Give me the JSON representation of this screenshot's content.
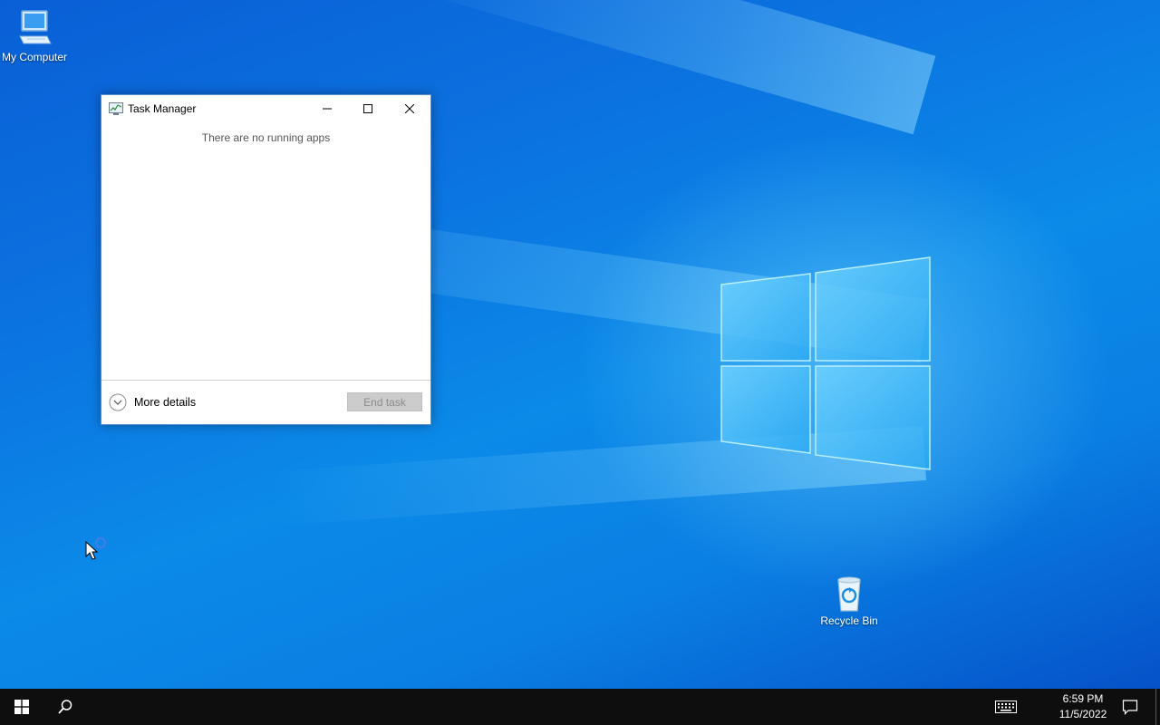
{
  "desktop": {
    "icons": [
      {
        "label": "My Computer"
      },
      {
        "label": "Recycle Bin"
      }
    ]
  },
  "task_manager": {
    "title": "Task Manager",
    "empty_message": "There are no running apps",
    "more_details_label": "More details",
    "end_task_label": "End task",
    "end_task_enabled": false
  },
  "taskbar": {
    "time": "6:59 PM",
    "date": "11/5/2022"
  },
  "colors": {
    "desktop_blue": "#0b73e0",
    "taskbar_bg": "#0e0e0f",
    "window_border": "#5a8fd0"
  }
}
